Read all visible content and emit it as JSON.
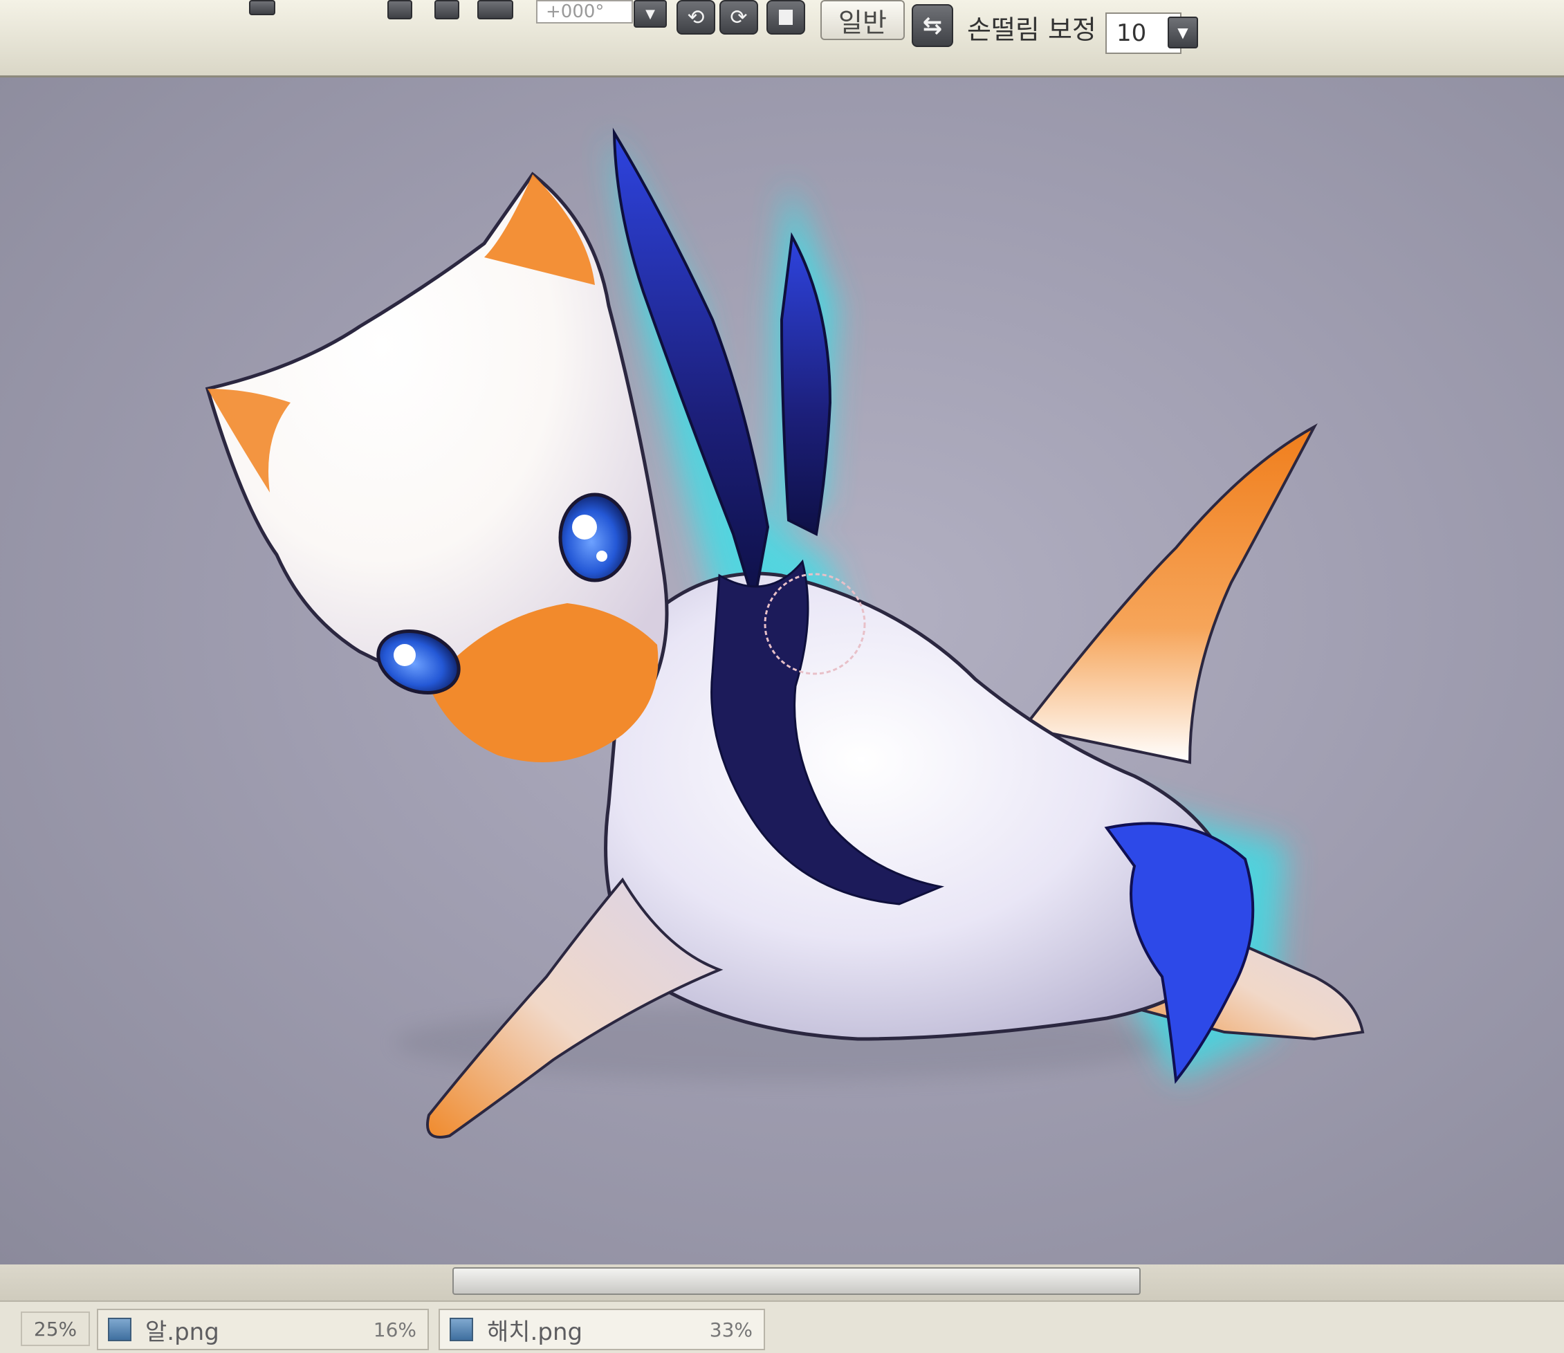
{
  "toolbar": {
    "angle_value": "+000°",
    "mode_button_label": "일반",
    "stabilizer_label": "손떨림 보정",
    "stabilizer_value": "10"
  },
  "status_bar": {
    "zoom": "25%",
    "documents": [
      {
        "name": "알.png",
        "zoom": "16%"
      },
      {
        "name": "해치.png",
        "zoom": "33%"
      }
    ]
  },
  "colors": {
    "canvas_bg": "#a3a1b3",
    "accent_glow": "#37e0ea",
    "fin_blue": "#2b3fd2",
    "body_orange": "#ef8020"
  }
}
